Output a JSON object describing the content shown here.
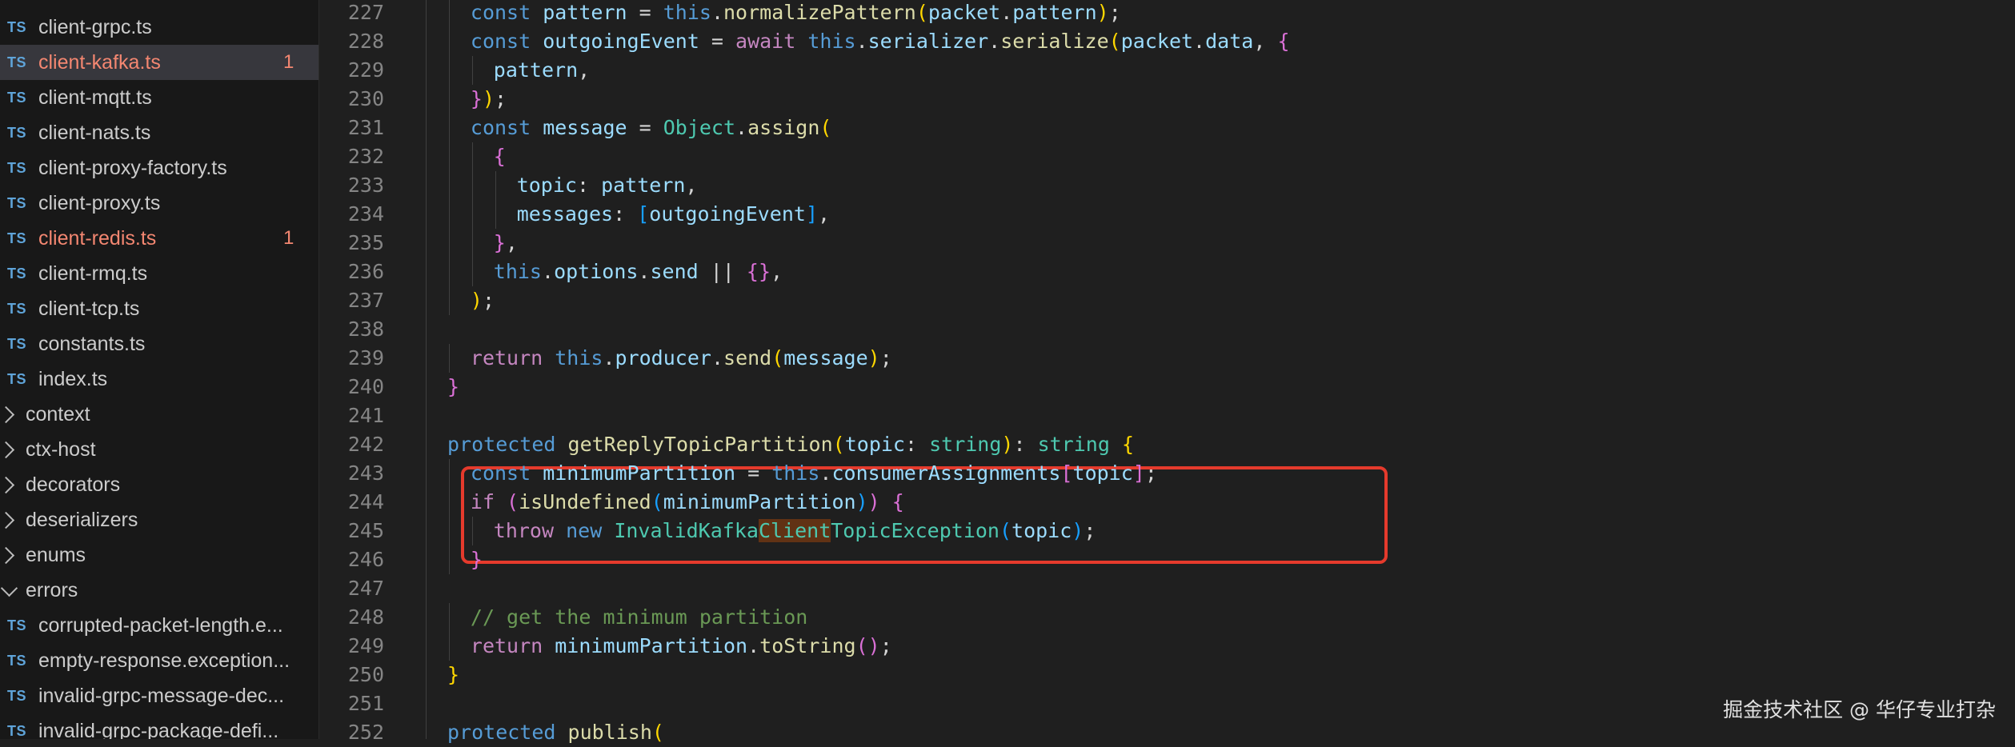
{
  "sidebar": {
    "ts_badge": "TS",
    "rows": [
      {
        "kind": "file",
        "label": "client-grpc.ts",
        "modified": false,
        "badge": ""
      },
      {
        "kind": "file",
        "label": "client-kafka.ts",
        "modified": true,
        "badge": "1",
        "selected": true
      },
      {
        "kind": "file",
        "label": "client-mqtt.ts",
        "modified": false,
        "badge": ""
      },
      {
        "kind": "file",
        "label": "client-nats.ts",
        "modified": false,
        "badge": ""
      },
      {
        "kind": "file",
        "label": "client-proxy-factory.ts",
        "modified": false,
        "badge": ""
      },
      {
        "kind": "file",
        "label": "client-proxy.ts",
        "modified": false,
        "badge": ""
      },
      {
        "kind": "file",
        "label": "client-redis.ts",
        "modified": true,
        "badge": "1"
      },
      {
        "kind": "file",
        "label": "client-rmq.ts",
        "modified": false,
        "badge": ""
      },
      {
        "kind": "file",
        "label": "client-tcp.ts",
        "modified": false,
        "badge": ""
      },
      {
        "kind": "file",
        "label": "constants.ts",
        "modified": false,
        "badge": ""
      },
      {
        "kind": "file",
        "label": "index.ts",
        "modified": false,
        "badge": ""
      },
      {
        "kind": "folder",
        "label": "context",
        "open": false
      },
      {
        "kind": "folder",
        "label": "ctx-host",
        "open": false
      },
      {
        "kind": "folder",
        "label": "decorators",
        "open": false
      },
      {
        "kind": "folder",
        "label": "deserializers",
        "open": false
      },
      {
        "kind": "folder",
        "label": "enums",
        "open": false
      },
      {
        "kind": "folder",
        "label": "errors",
        "open": true
      },
      {
        "kind": "file",
        "label": "corrupted-packet-length.e...",
        "modified": false,
        "badge": ""
      },
      {
        "kind": "file",
        "label": "empty-response.exception...",
        "modified": false,
        "badge": ""
      },
      {
        "kind": "file",
        "label": "invalid-grpc-message-dec...",
        "modified": false,
        "badge": ""
      },
      {
        "kind": "file",
        "label": "invalid-grpc-package-defi...",
        "modified": false,
        "badge": ""
      }
    ]
  },
  "editor": {
    "lines": [
      {
        "n": "227",
        "indent": 1,
        "tokens": [
          [
            "kw",
            "const "
          ],
          [
            "var",
            "pattern"
          ],
          [
            "pl",
            " = "
          ],
          [
            "kw",
            "this"
          ],
          [
            "pl",
            "."
          ],
          [
            "fn",
            "normalizePattern"
          ],
          [
            "br1",
            "("
          ],
          [
            "var",
            "packet"
          ],
          [
            "pl",
            "."
          ],
          [
            "var",
            "pattern"
          ],
          [
            "br1",
            ")"
          ],
          [
            "pl",
            ";"
          ]
        ]
      },
      {
        "n": "228",
        "indent": 1,
        "tokens": [
          [
            "kw",
            "const "
          ],
          [
            "var",
            "outgoingEvent"
          ],
          [
            "pl",
            " = "
          ],
          [
            "ctl",
            "await "
          ],
          [
            "kw",
            "this"
          ],
          [
            "pl",
            "."
          ],
          [
            "var",
            "serializer"
          ],
          [
            "pl",
            "."
          ],
          [
            "fn",
            "serialize"
          ],
          [
            "br1",
            "("
          ],
          [
            "var",
            "packet"
          ],
          [
            "pl",
            "."
          ],
          [
            "var",
            "data"
          ],
          [
            "pl",
            ", "
          ],
          [
            "br2",
            "{"
          ]
        ]
      },
      {
        "n": "229",
        "indent": 2,
        "tokens": [
          [
            "var",
            "pattern"
          ],
          [
            "pl",
            ","
          ]
        ]
      },
      {
        "n": "230",
        "indent": 1,
        "tokens": [
          [
            "br2",
            "}"
          ],
          [
            "br1",
            ")"
          ],
          [
            "pl",
            ";"
          ]
        ]
      },
      {
        "n": "231",
        "indent": 1,
        "tokens": [
          [
            "kw",
            "const "
          ],
          [
            "var",
            "message"
          ],
          [
            "pl",
            " = "
          ],
          [
            "ty",
            "Object"
          ],
          [
            "pl",
            "."
          ],
          [
            "fn",
            "assign"
          ],
          [
            "br1",
            "("
          ]
        ]
      },
      {
        "n": "232",
        "indent": 2,
        "tokens": [
          [
            "br2",
            "{"
          ]
        ]
      },
      {
        "n": "233",
        "indent": 3,
        "tokens": [
          [
            "var",
            "topic"
          ],
          [
            "pl",
            ": "
          ],
          [
            "var",
            "pattern"
          ],
          [
            "pl",
            ","
          ]
        ]
      },
      {
        "n": "234",
        "indent": 3,
        "tokens": [
          [
            "var",
            "messages"
          ],
          [
            "pl",
            ": "
          ],
          [
            "br3",
            "["
          ],
          [
            "var",
            "outgoingEvent"
          ],
          [
            "br3",
            "]"
          ],
          [
            "pl",
            ","
          ]
        ]
      },
      {
        "n": "235",
        "indent": 2,
        "tokens": [
          [
            "br2",
            "}"
          ],
          [
            "pl",
            ","
          ]
        ]
      },
      {
        "n": "236",
        "indent": 2,
        "tokens": [
          [
            "kw",
            "this"
          ],
          [
            "pl",
            "."
          ],
          [
            "var",
            "options"
          ],
          [
            "pl",
            "."
          ],
          [
            "var",
            "send"
          ],
          [
            "pl",
            " || "
          ],
          [
            "br2",
            "{}"
          ],
          [
            "pl",
            ","
          ]
        ]
      },
      {
        "n": "237",
        "indent": 1,
        "tokens": [
          [
            "br1",
            ")"
          ],
          [
            "pl",
            ";"
          ]
        ]
      },
      {
        "n": "238",
        "indent": 0,
        "tokens": []
      },
      {
        "n": "239",
        "indent": 1,
        "tokens": [
          [
            "ctl",
            "return "
          ],
          [
            "kw",
            "this"
          ],
          [
            "pl",
            "."
          ],
          [
            "var",
            "producer"
          ],
          [
            "pl",
            "."
          ],
          [
            "fn",
            "send"
          ],
          [
            "br1",
            "("
          ],
          [
            "var",
            "message"
          ],
          [
            "br1",
            ")"
          ],
          [
            "pl",
            ";"
          ]
        ]
      },
      {
        "n": "240",
        "indent": 0,
        "tokens": [
          [
            "br2",
            "}"
          ]
        ]
      },
      {
        "n": "241",
        "indent": 0,
        "tokens": []
      },
      {
        "n": "242",
        "indent": 0,
        "tokens": [
          [
            "kw",
            "protected "
          ],
          [
            "fn",
            "getReplyTopicPartition"
          ],
          [
            "br1",
            "("
          ],
          [
            "var",
            "topic"
          ],
          [
            "pl",
            ": "
          ],
          [
            "ty",
            "string"
          ],
          [
            "br1",
            ")"
          ],
          [
            "pl",
            ": "
          ],
          [
            "ty",
            "string"
          ],
          [
            "pl",
            " "
          ],
          [
            "br1",
            "{"
          ]
        ]
      },
      {
        "n": "243",
        "indent": 1,
        "tokens": [
          [
            "kw",
            "const "
          ],
          [
            "var",
            "minimumPartition"
          ],
          [
            "pl",
            " = "
          ],
          [
            "kw",
            "this"
          ],
          [
            "pl",
            "."
          ],
          [
            "var",
            "consumerAssignments"
          ],
          [
            "br2",
            "["
          ],
          [
            "var",
            "topic"
          ],
          [
            "br2",
            "]"
          ],
          [
            "pl",
            ";"
          ]
        ]
      },
      {
        "n": "244",
        "indent": 1,
        "tokens": [
          [
            "ctl",
            "if "
          ],
          [
            "br2",
            "("
          ],
          [
            "fn",
            "isUndefined"
          ],
          [
            "br3",
            "("
          ],
          [
            "var",
            "minimumPartition"
          ],
          [
            "br3",
            ")"
          ],
          [
            "br2",
            ")"
          ],
          [
            "pl",
            " "
          ],
          [
            "br2",
            "{"
          ]
        ]
      },
      {
        "n": "245",
        "indent": 2,
        "tokens": [
          [
            "ctl",
            "throw "
          ],
          [
            "kw",
            "new "
          ],
          [
            "ty",
            "InvalidKafka"
          ],
          [
            "tyhl",
            "Client"
          ],
          [
            "ty",
            "TopicException"
          ],
          [
            "br3",
            "("
          ],
          [
            "var",
            "topic"
          ],
          [
            "br3",
            ")"
          ],
          [
            "pl",
            ";"
          ]
        ]
      },
      {
        "n": "246",
        "indent": 1,
        "tokens": [
          [
            "br2",
            "}"
          ]
        ]
      },
      {
        "n": "247",
        "indent": 0,
        "tokens": []
      },
      {
        "n": "248",
        "indent": 1,
        "tokens": [
          [
            "cm",
            "// get the minimum partition"
          ]
        ]
      },
      {
        "n": "249",
        "indent": 1,
        "tokens": [
          [
            "ctl",
            "return "
          ],
          [
            "var",
            "minimumPartition"
          ],
          [
            "pl",
            "."
          ],
          [
            "fn",
            "toString"
          ],
          [
            "br2",
            "("
          ],
          [
            "br2",
            ")"
          ],
          [
            "pl",
            ";"
          ]
        ]
      },
      {
        "n": "250",
        "indent": 0,
        "tokens": [
          [
            "br1",
            "}"
          ]
        ]
      },
      {
        "n": "251",
        "indent": 0,
        "tokens": []
      },
      {
        "n": "252",
        "indent": 0,
        "tokens": [
          [
            "kw",
            "protected "
          ],
          [
            "fn",
            "publish"
          ],
          [
            "br1",
            "("
          ]
        ]
      }
    ]
  },
  "watermark": "掘金技术社区 @ 华仔专业打杂"
}
